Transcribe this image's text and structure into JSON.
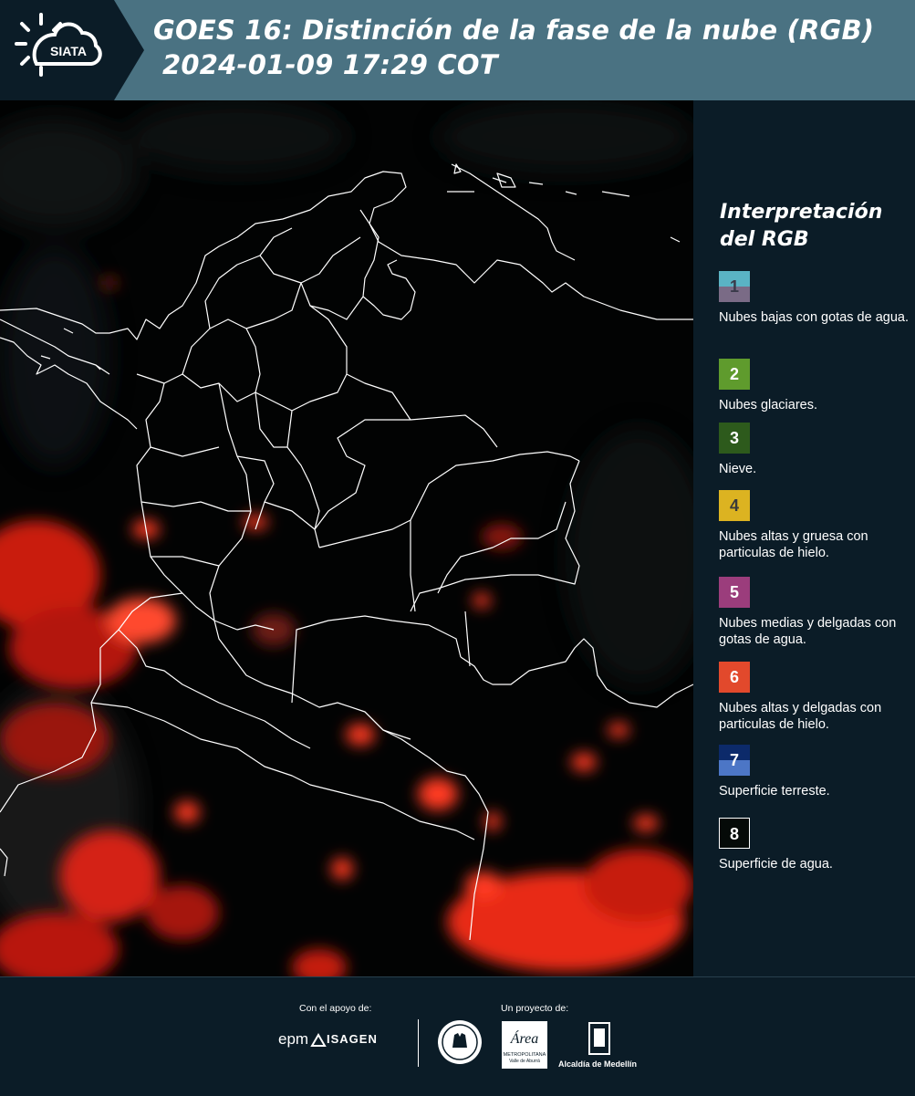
{
  "header": {
    "logo_text": "SIATA",
    "title_line1": "GOES 16: Distinción de la fase de la nube (RGB)",
    "title_line2": "2024-01-09 17:29 COT"
  },
  "legend": {
    "title": "Interpretación del RGB",
    "items": [
      {
        "number": "1",
        "label": "Nubes bajas con gotas de agua.",
        "colors": [
          "#5ab3c4",
          "#7a6b86"
        ],
        "number_color": "#3a3a4a"
      },
      {
        "number": "2",
        "label": "Nubes glaciares.",
        "colors": [
          "#5f9b2d"
        ],
        "number_color": "#ffffff"
      },
      {
        "number": "3",
        "label": "Nieve.",
        "colors": [
          "#2d5a1c"
        ],
        "number_color": "#ffffff"
      },
      {
        "number": "4",
        "label": "Nubes altas y gruesa con particulas de hielo.",
        "colors": [
          "#dcb321"
        ],
        "number_color": "#3a3a3a"
      },
      {
        "number": "5",
        "label": "Nubes medias y delgadas con gotas de agua.",
        "colors": [
          "#9b3d7c"
        ],
        "number_color": "#ffffff"
      },
      {
        "number": "6",
        "label": "Nubes altas y delgadas con particulas de hielo.",
        "colors": [
          "#e2492c"
        ],
        "number_color": "#ffffff"
      },
      {
        "number": "7",
        "label": "Superficie terreste.",
        "colors": [
          "#0c2a6a",
          "#4c76c6"
        ],
        "number_color": "#ffffff"
      },
      {
        "number": "8",
        "label": "Superficie de agua.",
        "colors": [
          "#050a08"
        ],
        "number_color": "#ffffff",
        "border": "#ffffff"
      }
    ]
  },
  "footer": {
    "support_label": "Con el apoyo de:",
    "project_label": "Un proyecto de:",
    "sponsor_epm": "epm",
    "sponsor_isagen": "ISAGEN",
    "logo_area_title": "Área",
    "logo_area_sub1": "METROPOLITANA",
    "logo_area_sub2": "Valle de Aburrá",
    "logo_medellin": "Alcaldía de Medellín"
  }
}
